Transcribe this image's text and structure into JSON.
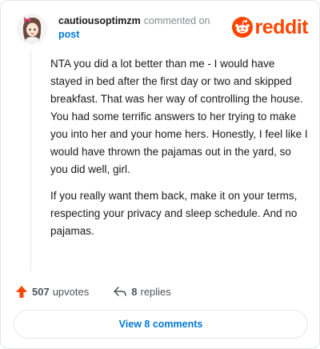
{
  "comment": {
    "username": "cautiousoptimzm",
    "action_text": "commented on",
    "post_link": "post",
    "paragraphs": [
      "NTA you did a lot better than me - I would have stayed in bed after the first day or two and skipped breakfast. That was her way of controlling the house. You had some terrific answers to her trying to make you into her and your home hers. Honestly, I feel like I would have thrown the pajamas out in the yard, so you did well, girl.",
      "If you really want them back, make it on your terms, respecting your privacy and sleep schedule. And no pajamas."
    ]
  },
  "brand": {
    "name": "reddit",
    "color": "#ff4500"
  },
  "actions": {
    "upvotes_count": "507",
    "upvotes_label": "upvotes",
    "upvote_icon": "upvote-arrow-icon",
    "replies_count": "8",
    "replies_label": "replies",
    "reply_icon": "reply-arrow-icon"
  },
  "view_comments_label": "View 8 comments",
  "colors": {
    "accent_blue": "#0079d3",
    "upvote_orange": "#ff4500",
    "muted": "#878a8c"
  }
}
